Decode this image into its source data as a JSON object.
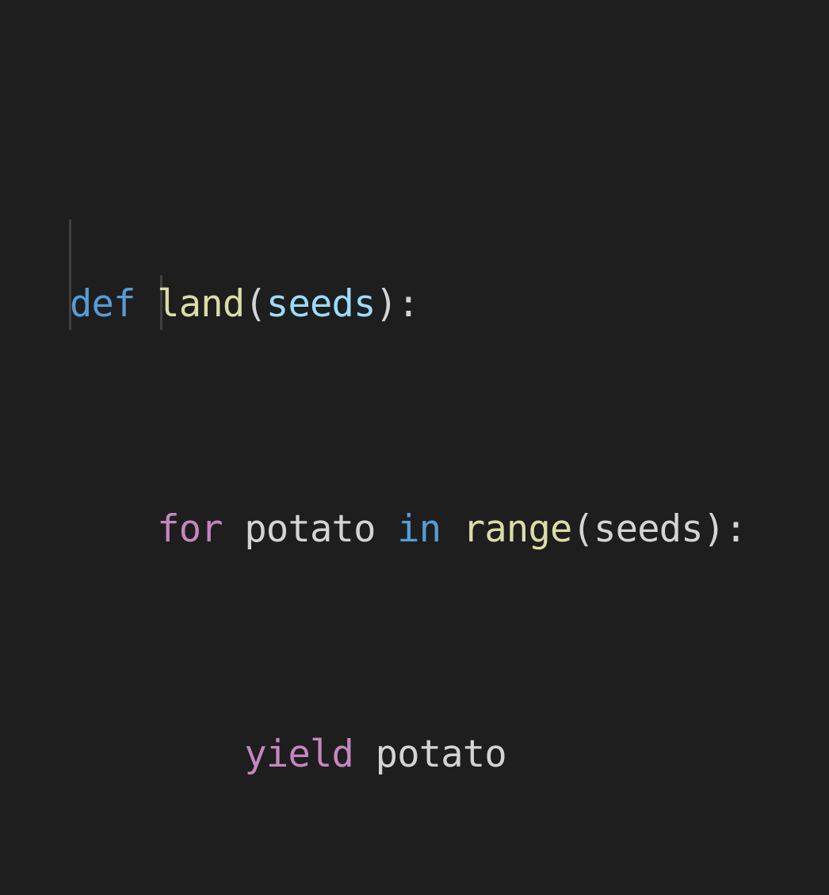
{
  "editor": {
    "background": "#1e1e1e",
    "colors": {
      "storage_keyword": "#569cd6",
      "control_keyword": "#c586c0",
      "function_name": "#dcdcaa",
      "parameter": "#9cdcfe",
      "plain": "#d4d4d4",
      "indent_guide": "#404040"
    },
    "lines": [
      {
        "tokens": [
          {
            "text": "def",
            "kind": "storage_keyword"
          },
          {
            "text": " ",
            "kind": "plain"
          },
          {
            "text": "land",
            "kind": "function_name"
          },
          {
            "text": "(",
            "kind": "plain"
          },
          {
            "text": "seeds",
            "kind": "parameter"
          },
          {
            "text": "):",
            "kind": "plain"
          }
        ]
      },
      {
        "tokens": [
          {
            "text": "    ",
            "kind": "plain"
          },
          {
            "text": "for",
            "kind": "control_keyword"
          },
          {
            "text": " potato ",
            "kind": "plain"
          },
          {
            "text": "in",
            "kind": "storage_keyword"
          },
          {
            "text": " ",
            "kind": "plain"
          },
          {
            "text": "range",
            "kind": "function_name"
          },
          {
            "text": "(seeds):",
            "kind": "plain"
          }
        ]
      },
      {
        "tokens": [
          {
            "text": "        ",
            "kind": "plain"
          },
          {
            "text": "yield",
            "kind": "control_keyword"
          },
          {
            "text": " potato",
            "kind": "plain"
          }
        ]
      }
    ]
  }
}
